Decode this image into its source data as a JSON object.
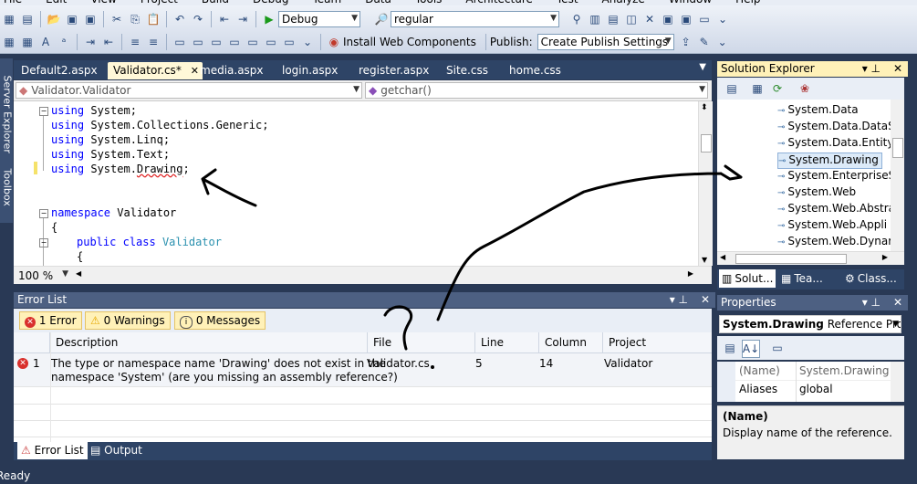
{
  "menu": {
    "items": [
      "File",
      "Edit",
      "View",
      "Project",
      "Build",
      "Debug",
      "Team",
      "Data",
      "Tools",
      "Architecture",
      "Test",
      "Analyze",
      "Window",
      "Help"
    ]
  },
  "toolbar": {
    "configuration": "Debug",
    "find_value": "regular",
    "install_web_components": "Install Web Components",
    "publish_label": "Publish:",
    "publish_profile": "Create Publish Settings"
  },
  "side_tabs": {
    "server_explorer": "Server Explorer",
    "toolbox": "Toolbox"
  },
  "document_tabs": [
    {
      "label": "Default2.aspx"
    },
    {
      "label": "Validator.cs*"
    },
    {
      "label": "media.aspx"
    },
    {
      "label": "login.aspx"
    },
    {
      "label": "register.aspx"
    },
    {
      "label": "Site.css"
    },
    {
      "label": "home.css"
    }
  ],
  "editor": {
    "type_dropdown": "Validator.Validator",
    "member_dropdown": "getchar()",
    "zoom": "100 %",
    "code": {
      "using": "using",
      "ns1": " System;",
      "ns2": " System.Collections.Generic;",
      "ns3": " System.Linq;",
      "ns4": " System.Text;",
      "ns5_prefix": " System.",
      "ns5_err": "Drawing",
      "ns5_suffix": ";",
      "namespace_kw": "namespace",
      "namespace_name": " Validator",
      "brace1": "{",
      "public_kw": "public",
      "class_kw": "class",
      "class_name": "Validator",
      "brace2": "{"
    }
  },
  "solution_explorer": {
    "title": "Solution Explorer",
    "items": [
      "System.Data",
      "System.Data.DataS",
      "System.Data.Entity",
      "System.Drawing",
      "System.EnterpriseS",
      "System.Web",
      "System.Web.Abstra",
      "System.Web.Appli",
      "System.Web.Dynar"
    ],
    "bottom_tabs": [
      "Solut...",
      "Tea...",
      "Class..."
    ]
  },
  "error_list": {
    "title": "Error List",
    "filters": {
      "errors": "1 Error",
      "warnings": "0 Warnings",
      "messages": "0 Messages"
    },
    "columns": [
      "Description",
      "File",
      "Line",
      "Column",
      "Project"
    ],
    "rows": [
      {
        "num": "1",
        "description1": "The type or namespace name 'Drawing' does not exist in the",
        "description2": "namespace 'System' (are you missing an assembly reference?)",
        "file": "Validator.cs",
        "line": "5",
        "column": "14",
        "project": "Validator"
      }
    ]
  },
  "bottom_tabs": {
    "error_list": "Error List",
    "output": "Output"
  },
  "properties": {
    "title": "Properties",
    "object_name": "System.Drawing",
    "object_type": "Reference Prope",
    "rows": [
      {
        "key": "(Name)",
        "value": "System.Drawing"
      },
      {
        "key": "Aliases",
        "value": "global"
      }
    ],
    "desc_title": "(Name)",
    "desc_text": "Display name of the reference."
  },
  "annotation": {
    "question": "?"
  },
  "status": {
    "text": "Ready"
  },
  "colors": {
    "background": "#293955",
    "tab_active": "#fff8d8",
    "panel_title": "#4d6082",
    "error_red": "#d9302c"
  }
}
